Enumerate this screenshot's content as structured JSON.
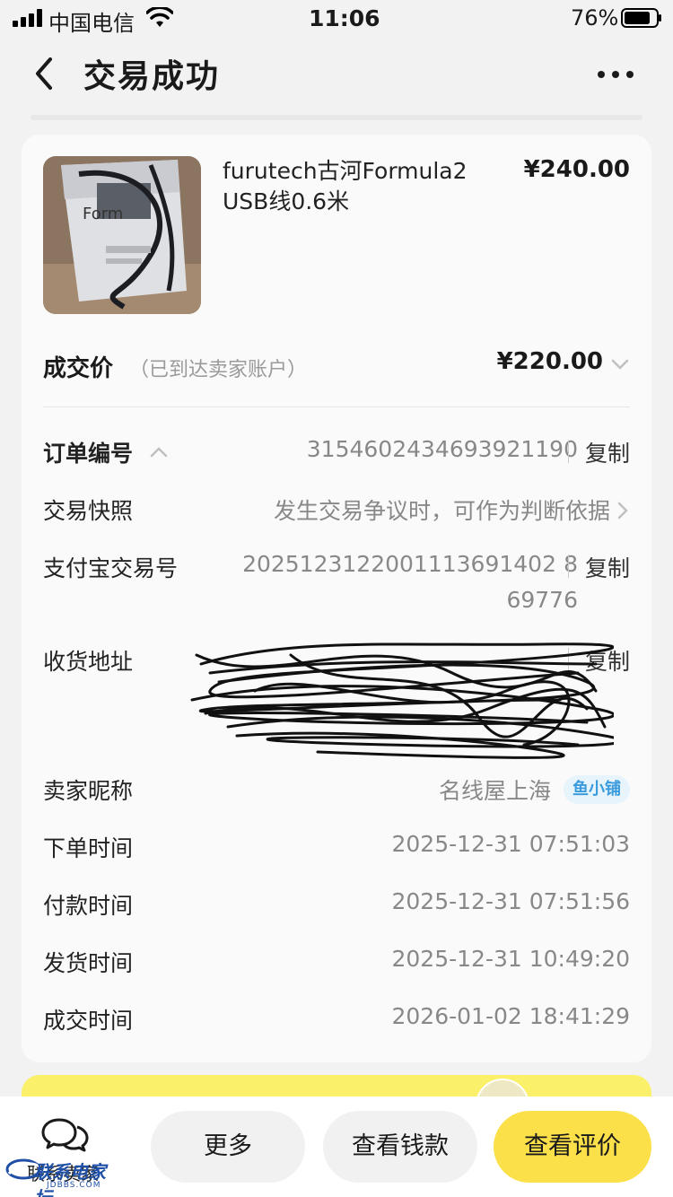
{
  "status_bar": {
    "carrier": "中国电信",
    "time": "11:06",
    "battery": "76%"
  },
  "nav": {
    "title": "交易成功"
  },
  "product": {
    "title": "furutech古河Formula2 USB线0.6米",
    "price": "¥240.00"
  },
  "deal": {
    "label": "成交价",
    "note": "（已到达卖家账户）",
    "price": "¥220.00"
  },
  "details": {
    "order_no_label": "订单编号",
    "order_no": "3154602434693921190",
    "snapshot_label": "交易快照",
    "snapshot_text": "发生交易争议时，可作为判断依据",
    "alipay_label": "支付宝交易号",
    "alipay_line1": "2025123122001113691402",
    "alipay_line2": "8",
    "alipay_line3": "69776",
    "address_label": "收货地址",
    "seller_label": "卖家昵称",
    "seller_name": "名线屋上海",
    "seller_badge": "鱼小铺",
    "order_time_label": "下单时间",
    "order_time": "2025-12-31 07:51:03",
    "pay_time_label": "付款时间",
    "pay_time": "2025-12-31 07:51:56",
    "ship_time_label": "发货时间",
    "ship_time": "2025-12-31 10:49:20",
    "deal_time_label": "成交时间",
    "deal_time": "2026-01-02 18:41:29",
    "copy_label": "复制"
  },
  "bottom_bar": {
    "contact": "联系卖家",
    "more": "更多",
    "view_money": "查看钱款",
    "view_review": "查看评价"
  },
  "watermark": {
    "text": "联系电家坛",
    "sub": "JDBBS.COM"
  },
  "colors": {
    "accent_yellow": "#fbe04a",
    "badge_blue": "#3a9bdc"
  }
}
